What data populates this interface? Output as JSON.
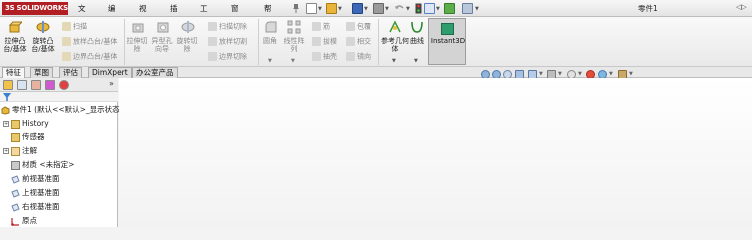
{
  "app": {
    "logo_text": "SOLIDWORKS",
    "logo_mark": "3S",
    "document_title": "零件1",
    "brand_color": "#b11e23"
  },
  "menu": {
    "items": [
      "文件(F)",
      "编辑(E)",
      "视图(V)",
      "插入(I)",
      "工具(T)",
      "窗口(W)",
      "帮助(H)"
    ],
    "pin_icon": "pin-icon"
  },
  "quick_access": {
    "icons": [
      "new-document-icon",
      "open-folder-icon",
      "save-icon",
      "print-icon",
      "undo-icon",
      "traffic-light-icon",
      "select-arrow-icon",
      "rebuild-icon",
      "options-icon"
    ]
  },
  "ribbon": {
    "extrude_boss": "拉伸凸台/基体",
    "revolve_boss": "旋转凸台/基体",
    "sweep_boss": "扫描",
    "loft_boss": "放样凸台/基体",
    "boundary_boss": "边界凸台/基体",
    "extrude_cut": "拉伸切除",
    "hole_wizard": "异型孔向导",
    "revolve_cut": "旋转切除",
    "sweep_cut": "扫描切除",
    "loft_cut": "放样切割",
    "boundary_cut": "边界切除",
    "fillet": "圆角",
    "linear_pattern": "线性阵列",
    "rib": "筋",
    "draft": "拔模",
    "shell": "抽壳",
    "wrap": "包覆",
    "intersect": "相交",
    "mirror": "镜向",
    "reference_geometry": "参考几何体",
    "curves": "曲线",
    "instant3d": "Instant3D"
  },
  "tabs": [
    "特征",
    "草图",
    "评估",
    "DimXpert",
    "办公室产品"
  ],
  "feature_tree": {
    "root": "零件1 (默认<<默认>_显示状态",
    "items": [
      "History",
      "传感器",
      "注解",
      "材质 <未指定>",
      "前视基准面",
      "上视基准面",
      "右视基准面",
      "原点"
    ]
  },
  "heads_up_toolbar": {
    "icons": [
      "zoom-to-fit-icon",
      "zoom-area-icon",
      "previous-view-icon",
      "section-view-icon",
      "view-orientation-icon",
      "display-style-icon",
      "hide-show-icon",
      "edit-appearance-icon",
      "apply-scene-icon",
      "view-settings-icon"
    ]
  }
}
